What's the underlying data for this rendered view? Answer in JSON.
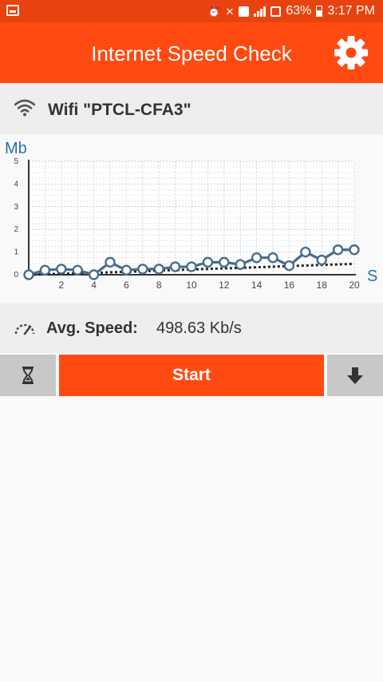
{
  "status_bar": {
    "battery": "63%",
    "time": "3:17 PM"
  },
  "app_bar": {
    "title": "Internet Speed Check",
    "settings_icon": "gear-icon"
  },
  "network": {
    "label": "Wifi \"PTCL-CFA3\"",
    "icon": "wifi-icon"
  },
  "chart_data": {
    "type": "line",
    "ylabel": "Mb",
    "xlabel": "S",
    "xlim": [
      0,
      20
    ],
    "ylim": [
      0,
      5
    ],
    "yticks": [
      "0",
      "1",
      "2",
      "3",
      "4",
      "5"
    ],
    "xticks": [
      "2",
      "4",
      "6",
      "8",
      "10",
      "12",
      "14",
      "16",
      "18",
      "20"
    ],
    "grid": true,
    "series": [
      {
        "style": "solid-with-markers",
        "x": [
          0,
          1,
          2,
          3,
          4,
          5,
          6,
          7,
          8,
          9,
          10,
          11,
          12,
          13,
          14,
          15,
          16,
          17,
          18,
          19,
          20
        ],
        "values": [
          0,
          0.2,
          0.25,
          0.2,
          0,
          0.55,
          0.2,
          0.25,
          0.25,
          0.35,
          0.35,
          0.55,
          0.55,
          0.45,
          0.75,
          0.75,
          0.4,
          1.0,
          0.65,
          1.1,
          1.1
        ]
      },
      {
        "style": "dotted",
        "x": [
          0,
          4,
          8,
          12,
          16,
          20
        ],
        "values": [
          0,
          0.08,
          0.18,
          0.28,
          0.38,
          0.48
        ]
      }
    ],
    "colors": {
      "line": "#4a6c8c",
      "dotted": "#222222",
      "axis_label": "#2a6fb0"
    }
  },
  "average": {
    "label": "Avg. Speed:",
    "value": "498.63 Kb/s",
    "icon": "speedometer-icon"
  },
  "controls": {
    "start_label": "Start",
    "timer_icon": "hourglass-icon",
    "download_icon": "arrow-down-icon"
  },
  "colors": {
    "accent": "#ff4a11",
    "status_bar": "#e8430f",
    "panel": "#eeeeee",
    "button_gray": "#c8c8c8"
  }
}
